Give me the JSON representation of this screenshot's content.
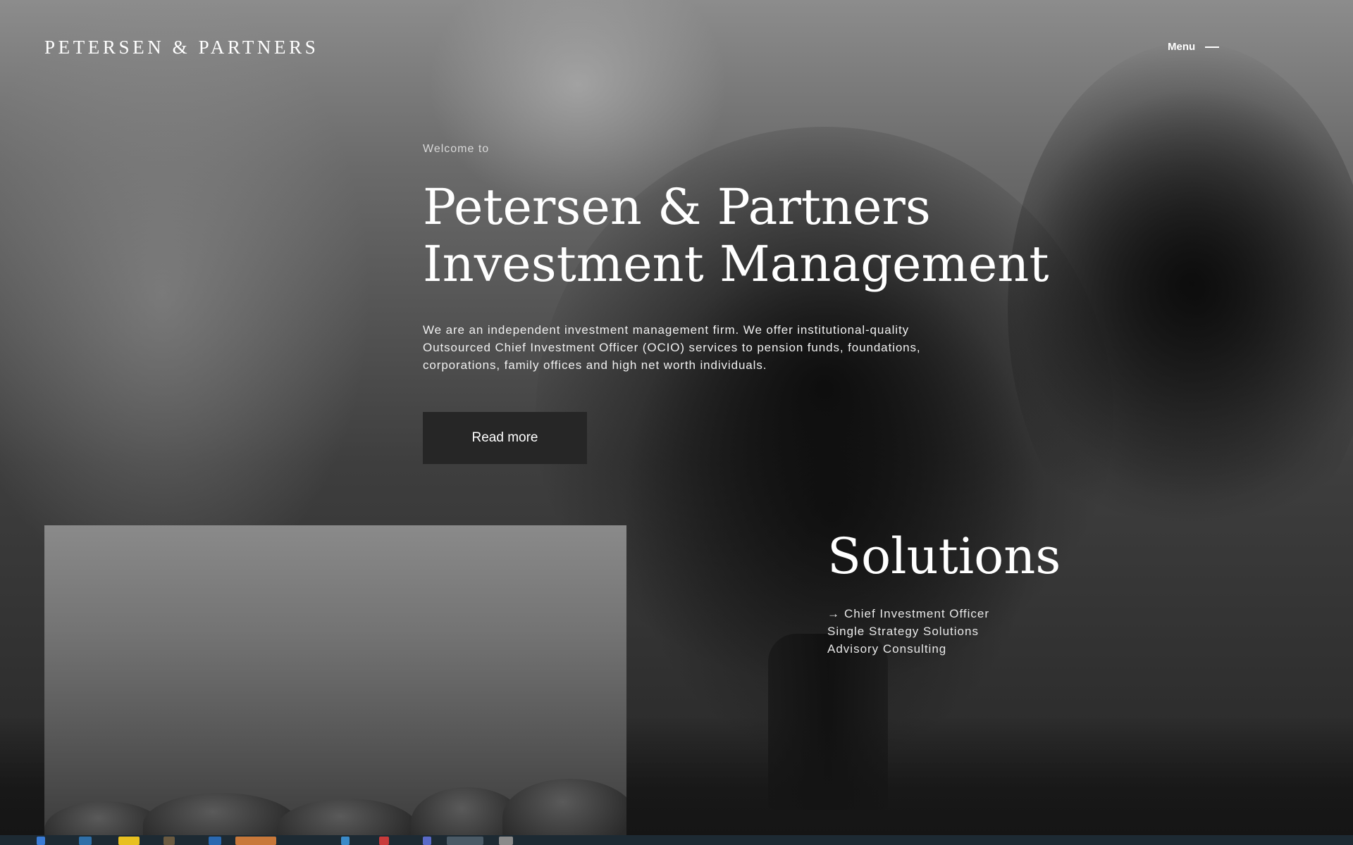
{
  "brand": {
    "logo_text": "PETERSEN & PARTNERS"
  },
  "nav": {
    "menu_label": "Menu",
    "menu_icon": "dash-icon"
  },
  "hero": {
    "welcome": "Welcome to",
    "title": "Petersen & Partners Investment Management",
    "description": "We are an independent investment management firm. We offer institutional-quality Outsourced Chief Investment Officer (OCIO) services to pension funds, foundations, corporations, family offices and high net worth individuals.",
    "read_more_label": "Read more"
  },
  "solutions": {
    "title": "Solutions",
    "items": [
      {
        "label": "Chief Investment Officer",
        "active": true,
        "icon": "right-arrow-icon",
        "arrow": "→"
      },
      {
        "label": "Single Strategy Solutions",
        "active": false
      },
      {
        "label": "Advisory Consulting",
        "active": false
      }
    ]
  },
  "colors": {
    "button_bg": "#262626",
    "text": "#ffffff",
    "taskbar": "#1d2a33"
  }
}
